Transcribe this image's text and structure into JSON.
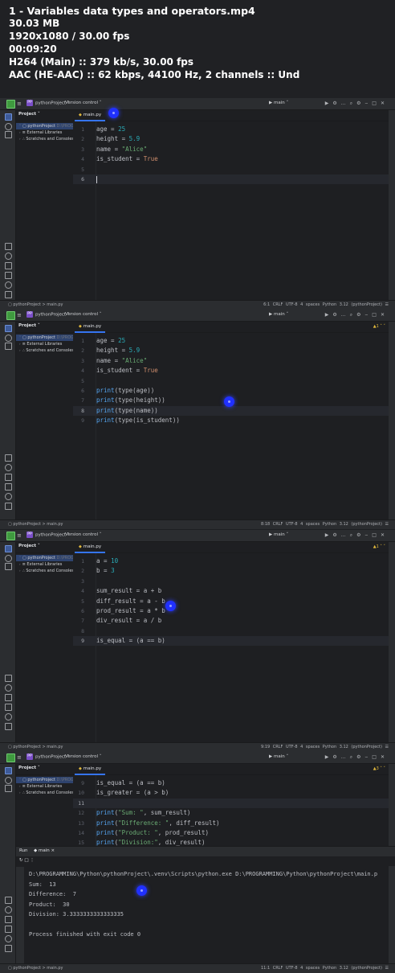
{
  "video_info": {
    "title": "1 - Variables data types and operators.mp4",
    "size": "30.03 MB",
    "resolution": "1920x1080 / 30.00 fps",
    "duration": "00:09:20",
    "video_codec": "H264 (Main) :: 379 kb/s, 30.00 fps",
    "audio_codec": "AAC (HE-AAC) :: 62 kbps, 44100 Hz, 2 channels :: Und"
  },
  "ide": {
    "project_label": "pythonProject",
    "project_badge": "PP",
    "version_control": "Version control",
    "branch": "main",
    "project_header": "Project",
    "tab_label": "main.py",
    "tree": {
      "root": "pythonProject",
      "root_path": "D:\\PROGRAM",
      "external": "External Libraries",
      "scratches": "Scratches and Consoles"
    },
    "breadcrumb": "pythonProject > main.py",
    "status_common": "CRLF  UTF-8  4 spaces  Python 3.12 (pythonProject)"
  },
  "frames": [
    {
      "cursor_pos": "6:1",
      "warning": "",
      "lines": [
        {
          "n": "1",
          "parts": [
            [
              "t",
              "age = "
            ],
            [
              "num",
              "25"
            ]
          ]
        },
        {
          "n": "2",
          "parts": [
            [
              "t",
              "height = "
            ],
            [
              "num",
              "5.9"
            ]
          ]
        },
        {
          "n": "3",
          "parts": [
            [
              "t",
              "name = "
            ],
            [
              "str",
              "\"Alice\""
            ]
          ]
        },
        {
          "n": "4",
          "parts": [
            [
              "t",
              "is_student = "
            ],
            [
              "kw",
              "True"
            ]
          ]
        },
        {
          "n": "5",
          "parts": []
        },
        {
          "n": "6",
          "parts": [],
          "current": true
        }
      ]
    },
    {
      "cursor_pos": "8:18",
      "warning": "1",
      "lines": [
        {
          "n": "1",
          "parts": [
            [
              "t",
              "age = "
            ],
            [
              "num",
              "25"
            ]
          ]
        },
        {
          "n": "2",
          "parts": [
            [
              "t",
              "height = "
            ],
            [
              "num",
              "5.9"
            ]
          ]
        },
        {
          "n": "3",
          "parts": [
            [
              "t",
              "name = "
            ],
            [
              "str",
              "\"Alice\""
            ]
          ]
        },
        {
          "n": "4",
          "parts": [
            [
              "t",
              "is_student = "
            ],
            [
              "kw",
              "True"
            ]
          ]
        },
        {
          "n": "5",
          "parts": []
        },
        {
          "n": "6",
          "parts": [
            [
              "fn",
              "print"
            ],
            [
              "t",
              "(type(age))"
            ]
          ]
        },
        {
          "n": "7",
          "parts": [
            [
              "fn",
              "print"
            ],
            [
              "t",
              "(type(height))"
            ]
          ]
        },
        {
          "n": "8",
          "parts": [
            [
              "fn",
              "print"
            ],
            [
              "t",
              "(type(name))"
            ]
          ],
          "current": true
        },
        {
          "n": "9",
          "parts": [
            [
              "fn",
              "print"
            ],
            [
              "t",
              "(type(is_student))"
            ]
          ]
        }
      ]
    },
    {
      "cursor_pos": "9:19",
      "warning": "1",
      "lines": [
        {
          "n": "1",
          "parts": [
            [
              "t",
              "a = "
            ],
            [
              "num",
              "10"
            ]
          ]
        },
        {
          "n": "2",
          "parts": [
            [
              "t",
              "b = "
            ],
            [
              "num",
              "3"
            ]
          ]
        },
        {
          "n": "3",
          "parts": []
        },
        {
          "n": "4",
          "parts": [
            [
              "t",
              "sum_result = a + b"
            ]
          ]
        },
        {
          "n": "5",
          "parts": [
            [
              "t",
              "diff_result = a - b"
            ]
          ]
        },
        {
          "n": "6",
          "parts": [
            [
              "t",
              "prod_result = a * b"
            ]
          ]
        },
        {
          "n": "7",
          "parts": [
            [
              "t",
              "div_result = a / b"
            ]
          ]
        },
        {
          "n": "8",
          "parts": []
        },
        {
          "n": "9",
          "parts": [
            [
              "t",
              "is_equal = (a == b)"
            ]
          ],
          "current": true
        }
      ]
    },
    {
      "cursor_pos": "11:1",
      "warning": "3",
      "lines": [
        {
          "n": "9",
          "parts": [
            [
              "t",
              "is_equal = (a == b)"
            ]
          ]
        },
        {
          "n": "10",
          "parts": [
            [
              "t",
              "is_greater = (a > b)"
            ]
          ]
        },
        {
          "n": "11",
          "parts": [],
          "current": true
        },
        {
          "n": "12",
          "parts": [
            [
              "fn",
              "print"
            ],
            [
              "t",
              "("
            ],
            [
              "str",
              "\"Sum: \""
            ],
            [
              "t",
              ", sum_result)"
            ]
          ]
        },
        {
          "n": "13",
          "parts": [
            [
              "fn",
              "print"
            ],
            [
              "t",
              "("
            ],
            [
              "str",
              "\"Difference: \""
            ],
            [
              "t",
              ", diff_result)"
            ]
          ]
        },
        {
          "n": "14",
          "parts": [
            [
              "fn",
              "print"
            ],
            [
              "t",
              "("
            ],
            [
              "str",
              "\"Product: \""
            ],
            [
              "t",
              ", prod_result)"
            ]
          ]
        },
        {
          "n": "15",
          "parts": [
            [
              "fn",
              "print"
            ],
            [
              "t",
              "("
            ],
            [
              "str",
              "\"Division:\""
            ],
            [
              "t",
              ", div_result)"
            ]
          ]
        }
      ],
      "run": {
        "label": "Run",
        "config": "main",
        "output": [
          "D:\\PROGRAMMING\\Python\\pythonProject\\.venv\\Scripts\\python.exe D:\\PROGRAMMING\\Python\\pythonProject\\main.p",
          "Sum:  13",
          "Difference:  7",
          "Product:  30",
          "Division: 3.3333333333333335",
          "",
          "Process finished with exit code 0"
        ]
      }
    }
  ],
  "colors": {
    "accent": "#3574f0",
    "number": "#2aacb8",
    "string": "#6aab73",
    "keyword": "#cf8e6d",
    "function": "#56a8f5",
    "cursor_dot": "#2030ff"
  }
}
